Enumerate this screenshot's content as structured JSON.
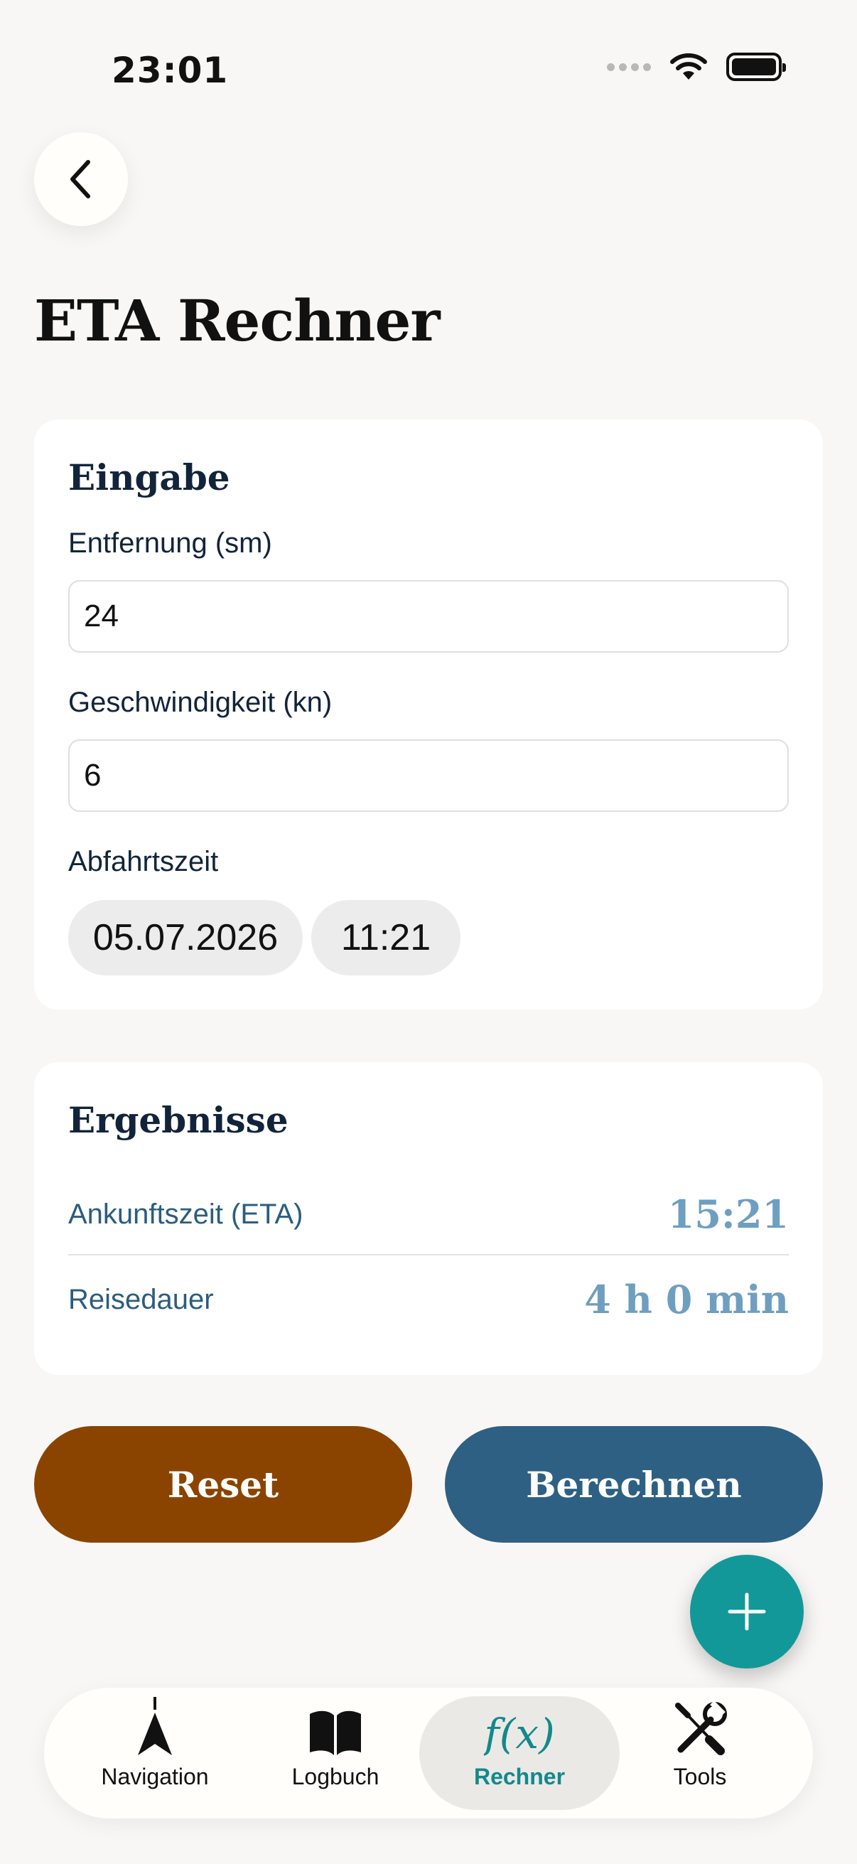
{
  "status_bar": {
    "time": "23:01"
  },
  "header": {
    "title": "ETA Rechner"
  },
  "input_card": {
    "heading": "Eingabe",
    "distance_label": "Entfernung (sm)",
    "distance_value": "24",
    "speed_label": "Geschwindigkeit (kn)",
    "speed_value": "6",
    "departure_label": "Abfahrtszeit",
    "departure_date": "05.07.2026",
    "departure_time": "11:21"
  },
  "results_card": {
    "heading": "Ergebnisse",
    "rows": [
      {
        "label": "Ankunftszeit (ETA)",
        "value": "15:21"
      },
      {
        "label": "Reisedauer",
        "value": "4 h 0 min"
      }
    ]
  },
  "actions": {
    "reset_label": "Reset",
    "calculate_label": "Berechnen"
  },
  "tab_bar": {
    "items": [
      {
        "label": "Navigation",
        "icon": "navigation-arrow-icon",
        "active": false
      },
      {
        "label": "Logbuch",
        "icon": "open-book-icon",
        "active": false
      },
      {
        "label": "Rechner",
        "icon": "function-icon",
        "active": true
      },
      {
        "label": "Tools",
        "icon": "tools-icon",
        "active": false
      }
    ]
  },
  "colors": {
    "background": "#f9f7f5",
    "reset_button": "#8b4400",
    "calculate_button": "#2e6083",
    "fab": "#129899",
    "active_tab_text": "#12898b",
    "result_value": "#6e9fc0"
  }
}
